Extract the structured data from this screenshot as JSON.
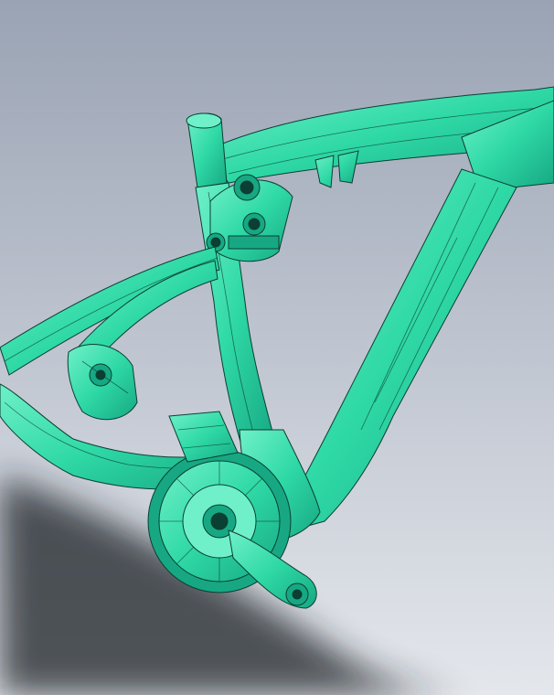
{
  "scene": {
    "subject": "bicycle-frame-cad-render",
    "colors": {
      "background_top": "#9aa3b4",
      "background_bottom": "#e4e7ec",
      "part_fill": "#2fd9a6",
      "part_light": "#6ff0c8",
      "part_dark": "#17a883",
      "edge_line": "#0b3f33",
      "ground_shadow": "#1f2127"
    }
  }
}
